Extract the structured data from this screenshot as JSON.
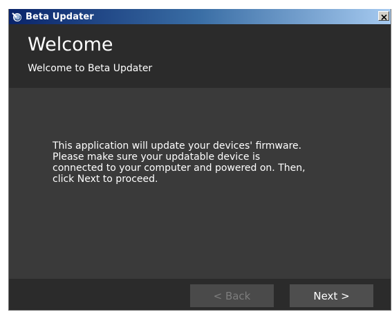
{
  "window": {
    "title": "Beta Updater",
    "app_icon": "updater-app-icon",
    "close_icon": "close-icon"
  },
  "header": {
    "title": "Welcome",
    "subtitle": "Welcome to Beta Updater"
  },
  "content": {
    "body": "This application will update your devices' firmware.\nPlease make sure your updatable device is\nconnected to your computer and powered on. Then,\nclick Next to proceed."
  },
  "footer": {
    "back_label": "< Back",
    "next_label": "Next >"
  },
  "colors": {
    "titlebar_start": "#0a246a",
    "titlebar_end": "#a6caf0",
    "header_bg": "#2b2b2b",
    "content_bg": "#3a3a3a",
    "disabled_text": "#7d7d7d"
  }
}
